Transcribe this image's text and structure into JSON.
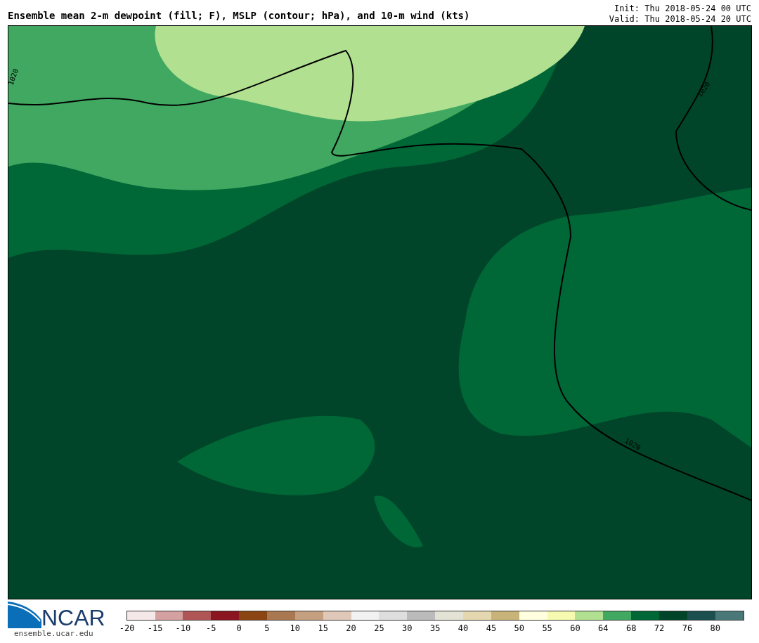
{
  "title": "Ensemble mean 2-m dewpoint (fill; F), MSLP (contour; hPa), and 10-m wind (kts)",
  "init": "Init: Thu 2018-05-24 00 UTC",
  "valid": "Valid: Thu 2018-05-24 20 UTC",
  "map": {
    "contour_labels": [
      "1020",
      "1020",
      "1020"
    ]
  },
  "logo": {
    "text": "NCAR",
    "url": "ensemble.ucar.edu"
  },
  "colorbar": [
    {
      "label": "-20",
      "color": "#f5e8e8"
    },
    {
      "label": "-15",
      "color": "#d4a0a0"
    },
    {
      "label": "-10",
      "color": "#b05555"
    },
    {
      "label": "-5",
      "color": "#8b1520"
    },
    {
      "label": "0",
      "color": "#8b4513"
    },
    {
      "label": "5",
      "color": "#a97850"
    },
    {
      "label": "10",
      "color": "#c4a080"
    },
    {
      "label": "15",
      "color": "#e0c8b8"
    },
    {
      "label": "20",
      "color": "#f2f2f2"
    },
    {
      "label": "25",
      "color": "#dedede"
    },
    {
      "label": "30",
      "color": "#bbbbbb"
    },
    {
      "label": "35",
      "color": "#e3e3d5"
    },
    {
      "label": "40",
      "color": "#e5d8b0"
    },
    {
      "label": "45",
      "color": "#c8b478"
    },
    {
      "label": "50",
      "color": "#ffffe0"
    },
    {
      "label": "55",
      "color": "#f5fab0"
    },
    {
      "label": "60",
      "color": "#b0e090"
    },
    {
      "label": "64",
      "color": "#40a860"
    },
    {
      "label": "68",
      "color": "#006837"
    },
    {
      "label": "72",
      "color": "#004529"
    },
    {
      "label": "76",
      "color": "#1c4f50"
    },
    {
      "label": "80",
      "color": "#4a7878"
    }
  ]
}
